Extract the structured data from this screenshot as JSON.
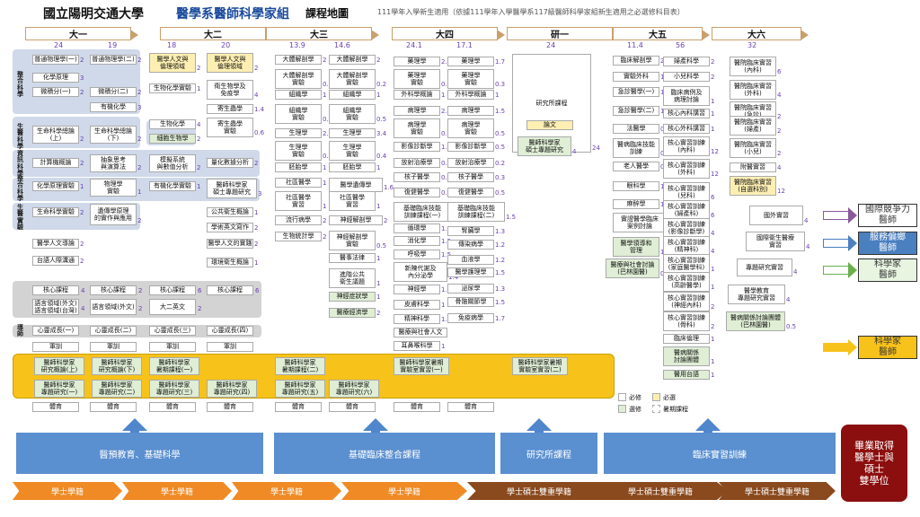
{
  "header": {
    "university": "國立陽明交通大學",
    "program": "醫學系醫師科學家組",
    "suffix": "課程地圖",
    "note": "111學年入學新生適用（依據111學年入學醫學系117級醫師科學家組新生適用之必選修科目表）"
  },
  "years": [
    {
      "label": "大一",
      "c1": "24",
      "c2": "19"
    },
    {
      "label": "大二",
      "c1": "18",
      "c2": "20"
    },
    {
      "label": "大三",
      "c1": "13.9",
      "c2": "14.6"
    },
    {
      "label": "大四",
      "c1": "24.1",
      "c2": "17.1"
    },
    {
      "label": "研一",
      "c1": "24",
      "c2": ""
    },
    {
      "label": "大五",
      "c1": "11.4",
      "c2": "56"
    },
    {
      "label": "大六",
      "c1": "32",
      "c2": ""
    }
  ],
  "side_labels": [
    "整合科學",
    "生醫科學",
    "資訊科學",
    "整合科學",
    "生醫實驗",
    "導師"
  ],
  "courses": [
    {
      "t": "普通物理學(一)",
      "n": "2",
      "s": "r"
    },
    {
      "t": "普通物理學(二)",
      "n": "2",
      "s": "r"
    },
    {
      "t": "化學原理",
      "n": "3",
      "s": "r"
    },
    {
      "t": "微積分(一)",
      "n": "2",
      "s": "r"
    },
    {
      "t": "微積分(二)",
      "n": "2",
      "s": "r"
    },
    {
      "t": "有機化學",
      "n": "3",
      "s": "r"
    },
    {
      "t": "生命科學總論\n(上)",
      "n": "2",
      "s": "r"
    },
    {
      "t": "生命科學總論\n(下)",
      "n": "2",
      "s": "r"
    },
    {
      "t": "計算機概論",
      "n": "2",
      "s": "r"
    },
    {
      "t": "抽象思考\n與演算法",
      "n": "2",
      "s": "r"
    },
    {
      "t": "化學原理實驗",
      "n": "1",
      "s": "r"
    },
    {
      "t": "物理學\n實驗",
      "n": "1",
      "s": "r"
    },
    {
      "t": "生命科學實驗",
      "n": "2",
      "s": "r"
    },
    {
      "t": "遺傳學原理\n的實作與應用",
      "n": "2",
      "s": "r"
    },
    {
      "t": "醫學人文導論",
      "n": "2",
      "s": "r"
    },
    {
      "t": "台語人際溝通",
      "n": "2",
      "s": "r"
    },
    {
      "t": "醫學人文與\n倫理領域",
      "n": "2",
      "s": "y"
    },
    {
      "t": "醫學人文與\n倫理領域",
      "n": "2",
      "s": "y"
    },
    {
      "t": "生物化學實驗",
      "n": "1",
      "s": "r"
    },
    {
      "t": "衛生物學及\n免疫學",
      "n": "4",
      "s": "r"
    },
    {
      "t": "寄生蟲學",
      "n": "1.4",
      "s": "r"
    },
    {
      "t": "生物化學",
      "n": "4",
      "s": "r"
    },
    {
      "t": "寄生蟲學\n實驗",
      "n": "0.6",
      "s": "r"
    },
    {
      "t": "細胞生物學",
      "n": "2",
      "s": "s"
    },
    {
      "t": "模擬系統\n與數值分析",
      "n": "2",
      "s": "r"
    },
    {
      "t": "量化數據分析",
      "n": "2",
      "s": "r"
    },
    {
      "t": "有機化學實驗",
      "n": "1",
      "s": "r"
    },
    {
      "t": "醫師科學家\n碩士專題研究",
      "n": "3",
      "s": "r"
    },
    {
      "t": "公共衛生概論",
      "n": "1",
      "s": "r"
    },
    {
      "t": "學術英文寫作",
      "n": "2",
      "s": "r"
    },
    {
      "t": "醫學人文的實踐",
      "n": "2",
      "s": "r"
    },
    {
      "t": "環境衛生概論",
      "n": "1",
      "s": "r"
    },
    {
      "t": "大體解剖學",
      "n": "2",
      "s": "r"
    },
    {
      "t": "大體解剖學",
      "n": "2",
      "s": "r"
    },
    {
      "t": "大體解剖學\n實驗",
      "n": "0.8",
      "s": "r"
    },
    {
      "t": "大體解剖學\n實驗",
      "n": "0.2",
      "s": "r"
    },
    {
      "t": "組織學",
      "n": "1",
      "s": "r"
    },
    {
      "t": "組織學",
      "n": "1",
      "s": "r"
    },
    {
      "t": "組織學\n實驗",
      "n": "0.5",
      "s": "r"
    },
    {
      "t": "組織學\n實驗",
      "n": "0.5",
      "s": "r"
    },
    {
      "t": "生理學",
      "n": "2.2",
      "s": "r"
    },
    {
      "t": "生理學",
      "n": "3.4",
      "s": "r"
    },
    {
      "t": "生理學\n實驗",
      "n": "0.8",
      "s": "r"
    },
    {
      "t": "生理學\n實驗",
      "n": "0.4",
      "s": "r"
    },
    {
      "t": "胚胎學",
      "n": "1",
      "s": "r"
    },
    {
      "t": "胚胎學",
      "n": "1",
      "s": "r"
    },
    {
      "t": "社區醫學",
      "n": "1",
      "s": "r"
    },
    {
      "t": "醫學遺傳學",
      "n": "1.6",
      "s": "r"
    },
    {
      "t": "社區醫學\n實習",
      "n": "1",
      "s": "r"
    },
    {
      "t": "社區醫學\n實習",
      "n": "1",
      "s": "r"
    },
    {
      "t": "流行病學",
      "n": "2",
      "s": "r"
    },
    {
      "t": "神經解剖學",
      "n": "2",
      "s": "r"
    },
    {
      "t": "生物統計學",
      "n": "2",
      "s": "r"
    },
    {
      "t": "神經解剖學\n實驗",
      "n": "0.5",
      "s": "r"
    },
    {
      "t": "醫事法律",
      "n": "1",
      "s": "r"
    },
    {
      "t": "進階公共\n衛生議題",
      "n": "1",
      "s": "r"
    },
    {
      "t": "神經症狀學",
      "n": "1",
      "s": "s"
    },
    {
      "t": "醫療經濟學",
      "n": "2",
      "s": "s"
    },
    {
      "t": "藥理學",
      "n": "2.7",
      "s": "r"
    },
    {
      "t": "藥理學",
      "n": "1.7",
      "s": "r"
    },
    {
      "t": "藥理學\n實驗",
      "n": "0.3",
      "s": "r"
    },
    {
      "t": "藥理學\n實驗",
      "n": "0.3",
      "s": "r"
    },
    {
      "t": "外科學概論",
      "n": "1",
      "s": "r"
    },
    {
      "t": "外科學概論",
      "n": "1",
      "s": "r"
    },
    {
      "t": "病理學",
      "n": "2.5",
      "s": "r"
    },
    {
      "t": "病理學",
      "n": "1.5",
      "s": "r"
    },
    {
      "t": "病理學\n實驗",
      "n": "0.5",
      "s": "r"
    },
    {
      "t": "病理學\n實驗",
      "n": "0.5",
      "s": "r"
    },
    {
      "t": "影像診斷學",
      "n": "1.5",
      "s": "r"
    },
    {
      "t": "影像診斷學",
      "n": "0.5",
      "s": "r"
    },
    {
      "t": "放射治療學",
      "n": "0.3",
      "s": "r"
    },
    {
      "t": "放射治療學",
      "n": "0.2",
      "s": "r"
    },
    {
      "t": "核子醫學",
      "n": "0.4",
      "s": "r"
    },
    {
      "t": "核子醫學",
      "n": "0.3",
      "s": "r"
    },
    {
      "t": "復健醫學",
      "n": "0.8",
      "s": "r"
    },
    {
      "t": "復健醫學",
      "n": "0.5",
      "s": "r"
    },
    {
      "t": "基礎臨床技能\n訓練課程(一)",
      "n": "1.5",
      "s": "r"
    },
    {
      "t": "基礎臨床技能\n訓練課程(二)",
      "n": "1.5",
      "s": "r"
    },
    {
      "t": "循環學",
      "n": "1.5",
      "s": "r"
    },
    {
      "t": "腎臟學",
      "n": "1.3",
      "s": "r"
    },
    {
      "t": "消化學",
      "n": "1.5",
      "s": "r"
    },
    {
      "t": "傳染病學",
      "n": "1.2",
      "s": "r"
    },
    {
      "t": "呼吸學",
      "n": "1.5",
      "s": "r"
    },
    {
      "t": "血液學",
      "n": "1.2",
      "s": "r"
    },
    {
      "t": "新陳代謝及\n內分泌學",
      "n": "1.4",
      "s": "r"
    },
    {
      "t": "醫學護理學",
      "n": "1.5",
      "s": "r"
    },
    {
      "t": "神經學",
      "n": "1.5",
      "s": "r"
    },
    {
      "t": "泌尿學",
      "n": "1.3",
      "s": "r"
    },
    {
      "t": "皮膚科學",
      "n": "1",
      "s": "r"
    },
    {
      "t": "骨骼關節學",
      "n": "1.5",
      "s": "r"
    },
    {
      "t": "精神科學",
      "n": "1.6",
      "s": "r"
    },
    {
      "t": "免疫病學",
      "n": "1.7",
      "s": "r"
    },
    {
      "t": "醫療與社會人文",
      "n": "",
      "s": "r"
    },
    {
      "t": "耳鼻喉科學",
      "n": "1",
      "s": "r"
    },
    {
      "t": "研究所課程",
      "n": "24",
      "s": "r"
    },
    {
      "t": "論文",
      "n": "",
      "s": "y"
    },
    {
      "t": "醫師科學家\n碩士專題研究",
      "n": "4",
      "s": "s"
    },
    {
      "t": "臨床解剖學",
      "n": "2",
      "s": "r"
    },
    {
      "t": "實驗外科",
      "n": "1",
      "s": "r"
    },
    {
      "t": "急診醫學(一)",
      "n": "1",
      "s": "r"
    },
    {
      "t": "急診醫學(二)",
      "n": "1",
      "s": "r"
    },
    {
      "t": "法醫學",
      "n": "0.8",
      "s": "r"
    },
    {
      "t": "醫病臨床技能\n訓練",
      "n": "0.5",
      "s": "r"
    },
    {
      "t": "老人醫學",
      "n": "0.5",
      "s": "r"
    },
    {
      "t": "眼科學",
      "n": "1.6",
      "s": "r"
    },
    {
      "t": "麻醉學",
      "n": "1",
      "s": "r"
    },
    {
      "t": "實證醫學臨床\n案例討論",
      "n": "1",
      "s": "r"
    },
    {
      "t": "醫學領導和\n管理",
      "n": "1",
      "s": "s"
    },
    {
      "t": "醫療與社會討論\n(巴林園醫)",
      "n": "0.5",
      "s": "s"
    },
    {
      "t": "婦產科學",
      "n": "2",
      "s": "r"
    },
    {
      "t": "小兒科學",
      "n": "2",
      "s": "r"
    },
    {
      "t": "臨床病例及\n病理討論",
      "n": "1",
      "s": "r"
    },
    {
      "t": "核心內科講習",
      "n": "1",
      "s": "r"
    },
    {
      "t": "核心外科講習",
      "n": "1",
      "s": "r"
    },
    {
      "t": "核心實習訓練\n(內科)",
      "n": "12",
      "s": "r"
    },
    {
      "t": "核心實習訓練\n(外科)",
      "n": "12",
      "s": "r"
    },
    {
      "t": "核心實習訓練\n(兒科)",
      "n": "6",
      "s": "r"
    },
    {
      "t": "核心實習訓練\n(婦產科)",
      "n": "6",
      "s": "r"
    },
    {
      "t": "核心實習訓練\n(影像診斷學)",
      "n": "4",
      "s": "r"
    },
    {
      "t": "核心實習訓練\n(精神科)",
      "n": "4",
      "s": "r"
    },
    {
      "t": "核心實習訓練\n(家庭醫學科)",
      "n": "1",
      "s": "r"
    },
    {
      "t": "核心實習訓練\n(高齡醫學)",
      "n": "1",
      "s": "r"
    },
    {
      "t": "核心實習訓練\n(神經內科)",
      "n": "2",
      "s": "r"
    },
    {
      "t": "核心實習訓練\n(骨科)",
      "n": "2",
      "s": "r"
    },
    {
      "t": "臨床倫理",
      "n": "1",
      "s": "r"
    },
    {
      "t": "醫病關係\n討論團體",
      "n": "1",
      "s": "s"
    },
    {
      "t": "醫用台語",
      "n": "1",
      "s": "s"
    },
    {
      "t": "醫院臨床實習\n(內科)",
      "n": "6",
      "s": "r"
    },
    {
      "t": "醫院臨床實習\n(外科)",
      "n": "4",
      "s": "r"
    },
    {
      "t": "醫院臨床實習\n(急診)",
      "n": "2",
      "s": "r"
    },
    {
      "t": "醫院臨床實習\n(婦產)",
      "n": "2",
      "s": "r"
    },
    {
      "t": "醫院臨床實習\n(小兒)",
      "n": "2",
      "s": "r"
    },
    {
      "t": "附醫實習",
      "n": "4",
      "s": "r"
    },
    {
      "t": "醫院臨床實習\n(自選科別)",
      "n": "12",
      "s": "y"
    },
    {
      "t": "國外實習",
      "n": "4",
      "s": "r"
    },
    {
      "t": "國際衛生醫療\n實習",
      "n": "4",
      "s": "r"
    },
    {
      "t": "專題研究實習",
      "n": "4",
      "s": "r"
    },
    {
      "t": "醫學教育\n專題研究實習",
      "n": "4",
      "s": "r"
    },
    {
      "t": "醫病關係討論團體\n(巴林園醫)",
      "n": "0.5",
      "s": "s"
    }
  ],
  "core": {
    "row1": [
      "核心課程",
      "核心課程",
      "核心課程",
      "核心課程"
    ],
    "nums1": [
      "4",
      "2",
      "6",
      "6"
    ],
    "row2": [
      "語言領域(外文)\n語言領域(台灣)",
      "語言領域(外文)",
      "大二英文"
    ],
    "nums2": [
      "4",
      "2",
      "2"
    ],
    "mentor": [
      "心靈成長(一)",
      "心靈成長(二)",
      "心靈成長(三)",
      "心靈成長(四)"
    ],
    "army": [
      "軍訓",
      "軍訓",
      "軍訓",
      "軍訓"
    ],
    "pe": [
      "體育",
      "體育",
      "體育",
      "體育",
      "體育",
      "體育",
      "體育",
      "體育"
    ]
  },
  "research": [
    "醫師科學家\n研究概論(上)",
    "醫師科學家\n研究概論(下)",
    "醫師科學家\n暑期課程(一)",
    "醫師科學家\n暑期課程(二)",
    "醫師科學家暑期\n實驗室實習(一)",
    "醫師科學家暑期\n實驗室實習(二)",
    "醫師科學家\n專題研究(一)",
    "醫師科學家\n專題研究(二)",
    "醫師科學家\n專題研究(三)",
    "醫師科學家\n專題研究(四)",
    "醫師科學家\n專題研究(五)",
    "醫師科學家\n專題研究(六)"
  ],
  "legend": {
    "required": "必修",
    "selected": "選修",
    "must_select": "必選",
    "summer": "暑期課程"
  },
  "outcomes": [
    "國際競爭力\n醫師",
    "服務偏鄉\n醫師",
    "科學家\n醫師",
    "科學家\n醫師"
  ],
  "blocks": [
    "醫預教育、基礎科學",
    "基礎臨床整合課程",
    "研究所課程",
    "臨床實習訓練"
  ],
  "tracks": [
    "學士學籍",
    "學士學籍",
    "學士學籍",
    "學士學籍",
    "學士碩士雙重學籍",
    "學士碩士雙重學籍",
    "學士碩士雙重學籍"
  ],
  "final": "畢業取得\n醫學士與\n碩士\n雙學位"
}
